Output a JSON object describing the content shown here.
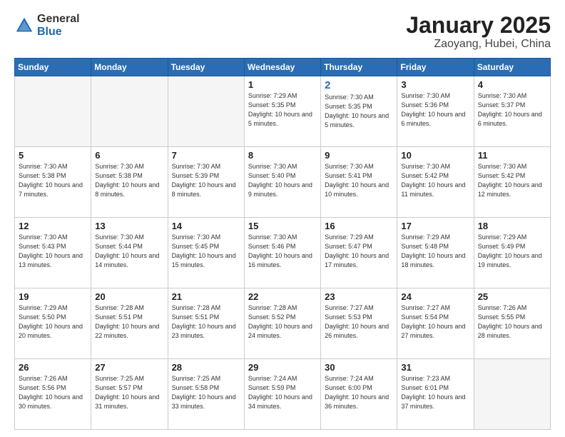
{
  "logo": {
    "general": "General",
    "blue": "Blue"
  },
  "header": {
    "month": "January 2025",
    "location": "Zaoyang, Hubei, China"
  },
  "weekdays": [
    "Sunday",
    "Monday",
    "Tuesday",
    "Wednesday",
    "Thursday",
    "Friday",
    "Saturday"
  ],
  "weeks": [
    [
      {
        "day": "",
        "empty": true
      },
      {
        "day": "",
        "empty": true
      },
      {
        "day": "",
        "empty": true
      },
      {
        "day": "1",
        "sunrise": "7:29 AM",
        "sunset": "5:35 PM",
        "daylight": "10 hours and 5 minutes."
      },
      {
        "day": "2",
        "sunrise": "7:30 AM",
        "sunset": "5:35 PM",
        "daylight": "10 hours and 5 minutes.",
        "thursday": true
      },
      {
        "day": "3",
        "sunrise": "7:30 AM",
        "sunset": "5:36 PM",
        "daylight": "10 hours and 6 minutes."
      },
      {
        "day": "4",
        "sunrise": "7:30 AM",
        "sunset": "5:37 PM",
        "daylight": "10 hours and 6 minutes."
      }
    ],
    [
      {
        "day": "5",
        "sunrise": "7:30 AM",
        "sunset": "5:38 PM",
        "daylight": "10 hours and 7 minutes."
      },
      {
        "day": "6",
        "sunrise": "7:30 AM",
        "sunset": "5:38 PM",
        "daylight": "10 hours and 8 minutes."
      },
      {
        "day": "7",
        "sunrise": "7:30 AM",
        "sunset": "5:39 PM",
        "daylight": "10 hours and 8 minutes."
      },
      {
        "day": "8",
        "sunrise": "7:30 AM",
        "sunset": "5:40 PM",
        "daylight": "10 hours and 9 minutes."
      },
      {
        "day": "9",
        "sunrise": "7:30 AM",
        "sunset": "5:41 PM",
        "daylight": "10 hours and 10 minutes."
      },
      {
        "day": "10",
        "sunrise": "7:30 AM",
        "sunset": "5:42 PM",
        "daylight": "10 hours and 11 minutes."
      },
      {
        "day": "11",
        "sunrise": "7:30 AM",
        "sunset": "5:42 PM",
        "daylight": "10 hours and 12 minutes."
      }
    ],
    [
      {
        "day": "12",
        "sunrise": "7:30 AM",
        "sunset": "5:43 PM",
        "daylight": "10 hours and 13 minutes."
      },
      {
        "day": "13",
        "sunrise": "7:30 AM",
        "sunset": "5:44 PM",
        "daylight": "10 hours and 14 minutes."
      },
      {
        "day": "14",
        "sunrise": "7:30 AM",
        "sunset": "5:45 PM",
        "daylight": "10 hours and 15 minutes."
      },
      {
        "day": "15",
        "sunrise": "7:30 AM",
        "sunset": "5:46 PM",
        "daylight": "10 hours and 16 minutes."
      },
      {
        "day": "16",
        "sunrise": "7:29 AM",
        "sunset": "5:47 PM",
        "daylight": "10 hours and 17 minutes."
      },
      {
        "day": "17",
        "sunrise": "7:29 AM",
        "sunset": "5:48 PM",
        "daylight": "10 hours and 18 minutes."
      },
      {
        "day": "18",
        "sunrise": "7:29 AM",
        "sunset": "5:49 PM",
        "daylight": "10 hours and 19 minutes."
      }
    ],
    [
      {
        "day": "19",
        "sunrise": "7:29 AM",
        "sunset": "5:50 PM",
        "daylight": "10 hours and 20 minutes."
      },
      {
        "day": "20",
        "sunrise": "7:28 AM",
        "sunset": "5:51 PM",
        "daylight": "10 hours and 22 minutes."
      },
      {
        "day": "21",
        "sunrise": "7:28 AM",
        "sunset": "5:51 PM",
        "daylight": "10 hours and 23 minutes."
      },
      {
        "day": "22",
        "sunrise": "7:28 AM",
        "sunset": "5:52 PM",
        "daylight": "10 hours and 24 minutes."
      },
      {
        "day": "23",
        "sunrise": "7:27 AM",
        "sunset": "5:53 PM",
        "daylight": "10 hours and 26 minutes."
      },
      {
        "day": "24",
        "sunrise": "7:27 AM",
        "sunset": "5:54 PM",
        "daylight": "10 hours and 27 minutes."
      },
      {
        "day": "25",
        "sunrise": "7:26 AM",
        "sunset": "5:55 PM",
        "daylight": "10 hours and 28 minutes."
      }
    ],
    [
      {
        "day": "26",
        "sunrise": "7:26 AM",
        "sunset": "5:56 PM",
        "daylight": "10 hours and 30 minutes."
      },
      {
        "day": "27",
        "sunrise": "7:25 AM",
        "sunset": "5:57 PM",
        "daylight": "10 hours and 31 minutes."
      },
      {
        "day": "28",
        "sunrise": "7:25 AM",
        "sunset": "5:58 PM",
        "daylight": "10 hours and 33 minutes."
      },
      {
        "day": "29",
        "sunrise": "7:24 AM",
        "sunset": "5:59 PM",
        "daylight": "10 hours and 34 minutes."
      },
      {
        "day": "30",
        "sunrise": "7:24 AM",
        "sunset": "6:00 PM",
        "daylight": "10 hours and 36 minutes."
      },
      {
        "day": "31",
        "sunrise": "7:23 AM",
        "sunset": "6:01 PM",
        "daylight": "10 hours and 37 minutes."
      },
      {
        "day": "",
        "empty": true
      }
    ]
  ]
}
